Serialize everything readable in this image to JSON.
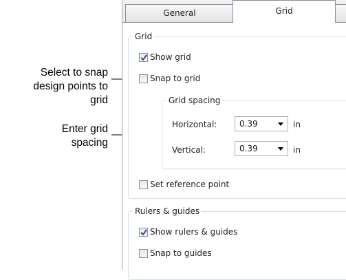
{
  "callouts": {
    "snap": [
      "Select to snap",
      "design points to",
      "grid"
    ],
    "spacing": [
      "Enter grid",
      "spacing"
    ]
  },
  "tabs": [
    {
      "label": "General",
      "active": false
    },
    {
      "label": "Grid",
      "active": true
    }
  ],
  "grid_group": {
    "title": "Grid",
    "show_grid": {
      "label": "Show grid",
      "checked": true
    },
    "snap_to_grid": {
      "label": "Snap to grid",
      "checked": false
    },
    "spacing_group": {
      "title": "Grid spacing",
      "horizontal": {
        "label": "Horizontal:",
        "value": "0.39",
        "unit": "in"
      },
      "vertical": {
        "label": "Vertical:",
        "value": "0.39",
        "unit": "in"
      }
    },
    "set_reference_point": {
      "label": "Set reference point",
      "checked": false
    }
  },
  "rulers_group": {
    "title": "Rulers & guides",
    "show_rulers": {
      "label": "Show rulers & guides",
      "checked": true
    },
    "snap_to_guides": {
      "label": "Snap to guides",
      "checked": false
    }
  }
}
